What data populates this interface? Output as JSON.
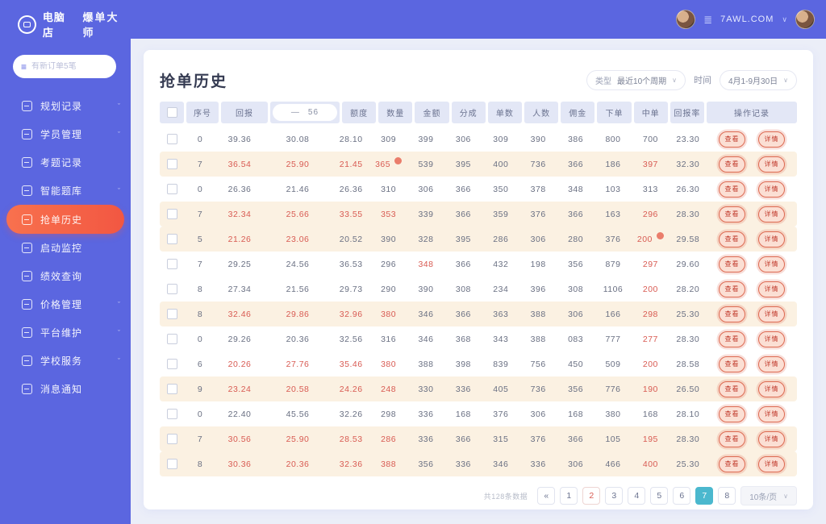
{
  "brand": {
    "name_left": "电脑店",
    "name_right": "爆单大师"
  },
  "topbar": {
    "username": "7AWL.COM",
    "chevron": "∨",
    "menu_icon": "≣"
  },
  "sidebar": {
    "search_placeholder": "有新订单5笔",
    "search_icon": "≡",
    "items": [
      {
        "label": "规划记录",
        "icon": "chart-icon",
        "chevron": true,
        "active": false
      },
      {
        "label": "学员管理",
        "icon": "user-icon",
        "chevron": true,
        "active": false
      },
      {
        "label": "考题记录",
        "icon": "list-icon",
        "chevron": false,
        "active": false
      },
      {
        "label": "智能题库",
        "icon": "library-icon",
        "chevron": true,
        "active": false
      },
      {
        "label": "抢单历史",
        "icon": "cart-icon",
        "chevron": false,
        "active": true
      },
      {
        "label": "启动监控",
        "icon": "monitor-icon",
        "chevron": false,
        "active": false
      },
      {
        "label": "绩效查询",
        "icon": "badge-icon",
        "chevron": false,
        "active": false
      },
      {
        "label": "价格管理",
        "icon": "price-icon",
        "chevron": true,
        "active": false
      },
      {
        "label": "平台维护",
        "icon": "tools-icon",
        "chevron": true,
        "active": false
      },
      {
        "label": "学校服务",
        "icon": "school-icon",
        "chevron": true,
        "active": false
      },
      {
        "label": "消息通知",
        "icon": "message-icon",
        "chevron": false,
        "active": false
      }
    ]
  },
  "page": {
    "title": "抢单历史"
  },
  "filters": {
    "period_label": "类型",
    "period_value": "最近10个周期",
    "period_chevron": "∨",
    "date_label": "时间",
    "date_value": "4月1-9月30日",
    "date_chevron": "∨"
  },
  "table": {
    "headers_left": [
      "序号",
      "回报"
    ],
    "range_pill": {
      "dash": "—",
      "value": "56"
    },
    "headers_right": [
      "额度",
      "数量",
      "金额",
      "分成",
      "单数",
      "人数",
      "佣金",
      "下单",
      "中单",
      "回报率"
    ],
    "op_header": "操作记录",
    "badge1": "查看",
    "badge2": "详情",
    "rows": [
      {
        "cells": [
          "0",
          "39.36",
          "30.08",
          "28.10",
          "309",
          "399",
          "306",
          "309",
          "390",
          "386",
          "800",
          "700",
          "23.30"
        ],
        "highlight": false,
        "red": [],
        "dot": null
      },
      {
        "cells": [
          "7",
          "36.54",
          "25.90",
          "21.45",
          "365",
          "539",
          "395",
          "400",
          "736",
          "366",
          "186",
          "397",
          "32.30"
        ],
        "highlight": true,
        "red": [
          1,
          2,
          3,
          4,
          11
        ],
        "dot": 4
      },
      {
        "cells": [
          "0",
          "26.36",
          "21.46",
          "26.36",
          "310",
          "306",
          "366",
          "350",
          "378",
          "348",
          "103",
          "313",
          "26.30"
        ],
        "highlight": false,
        "red": [],
        "dot": null
      },
      {
        "cells": [
          "7",
          "32.34",
          "25.66",
          "33.55",
          "353",
          "339",
          "366",
          "359",
          "376",
          "366",
          "163",
          "296",
          "28.30"
        ],
        "highlight": true,
        "red": [
          1,
          2,
          3,
          4,
          11
        ],
        "dot": null
      },
      {
        "cells": [
          "5",
          "21.26",
          "23.06",
          "20.52",
          "390",
          "328",
          "395",
          "286",
          "306",
          "280",
          "376",
          "200",
          "29.58"
        ],
        "highlight": true,
        "red": [
          1,
          2,
          11
        ],
        "dot": 11
      },
      {
        "cells": [
          "7",
          "29.25",
          "24.56",
          "36.53",
          "296",
          "348",
          "366",
          "432",
          "198",
          "356",
          "879",
          "297",
          "29.60"
        ],
        "highlight": false,
        "red": [
          5,
          11
        ],
        "dot": null
      },
      {
        "cells": [
          "8",
          "27.34",
          "21.56",
          "29.73",
          "290",
          "390",
          "308",
          "234",
          "396",
          "308",
          "1106",
          "200",
          "28.20"
        ],
        "highlight": false,
        "red": [
          11
        ],
        "dot": null
      },
      {
        "cells": [
          "8",
          "32.46",
          "29.86",
          "32.96",
          "380",
          "346",
          "366",
          "363",
          "388",
          "306",
          "166",
          "298",
          "25.30"
        ],
        "highlight": true,
        "red": [
          1,
          2,
          3,
          4,
          11
        ],
        "dot": null
      },
      {
        "cells": [
          "0",
          "29.26",
          "20.36",
          "32.56",
          "316",
          "346",
          "368",
          "343",
          "388",
          "083",
          "777",
          "277",
          "28.30"
        ],
        "highlight": false,
        "red": [
          11
        ],
        "dot": null
      },
      {
        "cells": [
          "6",
          "20.26",
          "27.76",
          "35.46",
          "380",
          "388",
          "398",
          "839",
          "756",
          "450",
          "509",
          "200",
          "28.58"
        ],
        "highlight": false,
        "red": [
          1,
          2,
          3,
          4,
          11
        ],
        "dot": null
      },
      {
        "cells": [
          "9",
          "23.24",
          "20.58",
          "24.26",
          "248",
          "330",
          "336",
          "405",
          "736",
          "356",
          "776",
          "190",
          "26.50"
        ],
        "highlight": true,
        "red": [
          1,
          2,
          3,
          4,
          11
        ],
        "dot": null
      },
      {
        "cells": [
          "0",
          "22.40",
          "45.56",
          "32.26",
          "298",
          "336",
          "168",
          "376",
          "306",
          "168",
          "380",
          "168",
          "28.10"
        ],
        "highlight": false,
        "red": [],
        "dot": null
      },
      {
        "cells": [
          "7",
          "30.56",
          "25.90",
          "28.53",
          "286",
          "336",
          "366",
          "315",
          "376",
          "366",
          "105",
          "195",
          "28.30"
        ],
        "highlight": true,
        "red": [
          1,
          2,
          3,
          4,
          11
        ],
        "dot": null
      },
      {
        "cells": [
          "8",
          "30.36",
          "20.36",
          "32.36",
          "388",
          "356",
          "336",
          "346",
          "336",
          "306",
          "466",
          "400",
          "25.30"
        ],
        "highlight": true,
        "red": [
          1,
          2,
          3,
          4,
          11
        ],
        "dot": null
      }
    ]
  },
  "pagination": {
    "total_text": "共128条数据",
    "prev": "«",
    "pages": [
      "1",
      "2",
      "3",
      "4",
      "5",
      "6",
      "7",
      "8"
    ],
    "red_page": "2",
    "active_page": "7",
    "page_size": "10条/页",
    "chevron": "∨"
  },
  "colors": {
    "accent_blue": "#5b66e0",
    "accent_red": "#f25742",
    "accent_teal": "#4bb8ce",
    "highlight_row": "#fbf1e2",
    "red_text": "#d85a52"
  }
}
